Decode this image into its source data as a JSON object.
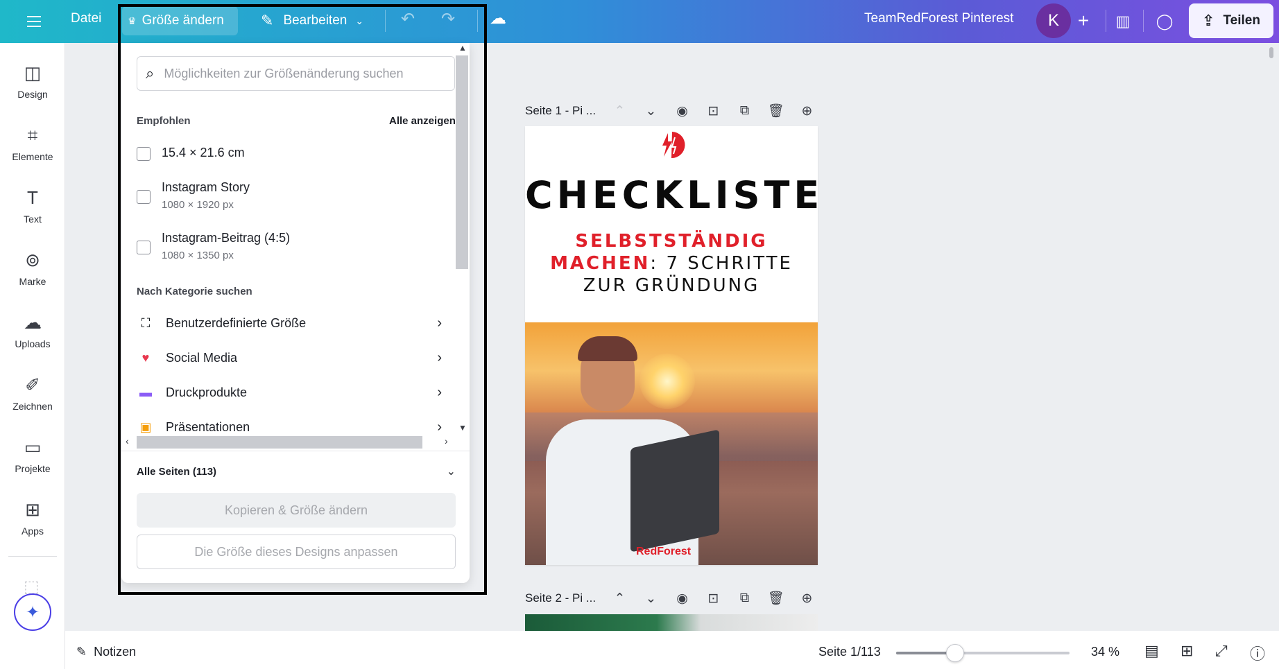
{
  "topbar": {
    "file_label": "Datei",
    "resize_label": "Größe ändern",
    "edit_label": "Bearbeiten",
    "team_name": "TeamRedForest Pinterest",
    "avatar_initial": "K",
    "share_label": "Teilen"
  },
  "sidebar": {
    "items": [
      {
        "label": "Design",
        "icon": "layout-icon"
      },
      {
        "label": "Elemente",
        "icon": "shapes-icon"
      },
      {
        "label": "Text",
        "icon": "text-icon"
      },
      {
        "label": "Marke",
        "icon": "brand-icon"
      },
      {
        "label": "Uploads",
        "icon": "cloud-upload-icon"
      },
      {
        "label": "Zeichnen",
        "icon": "draw-icon"
      },
      {
        "label": "Projekte",
        "icon": "folder-icon"
      },
      {
        "label": "Apps",
        "icon": "apps-icon"
      }
    ]
  },
  "resize_panel": {
    "search_placeholder": "Möglichkeiten zur Größenänderung suchen",
    "recommended_label": "Empfohlen",
    "show_all_label": "Alle anzeigen",
    "options": [
      {
        "title": "15.4 × 21.6 cm",
        "subtitle": ""
      },
      {
        "title": "Instagram Story",
        "subtitle": "1080 × 1920 px"
      },
      {
        "title": "Instagram-Beitrag (4:5)",
        "subtitle": "1080 × 1350 px"
      }
    ],
    "category_label": "Nach Kategorie suchen",
    "categories": [
      {
        "label": "Benutzerdefinierte Größe",
        "icon": "custom-size-icon",
        "color": "#1c1f26"
      },
      {
        "label": "Social Media",
        "icon": "heart-icon",
        "color": "#e8384f"
      },
      {
        "label": "Druckprodukte",
        "icon": "printer-icon",
        "color": "#8b5cf6"
      },
      {
        "label": "Präsentationen",
        "icon": "presentation-icon",
        "color": "#f59e0b"
      }
    ],
    "pages_label": "Alle Seiten (113)",
    "copy_button": "Kopieren & Größe ändern",
    "resize_button": "Die Größe dieses Designs anpassen"
  },
  "canvas": {
    "page1_label": "Seite 1 - Pi ...",
    "page2_label": "Seite 2 - Pi ...",
    "page1_title": "CHECKLISTE",
    "page1_sub_red1": "SELBSTSTÄNDIG",
    "page1_sub_red2": "MACHEN",
    "page1_sub_rest": ": 7 SCHRITTE",
    "page1_sub_line3": "ZUR GRÜNDUNG",
    "page1_brand": "RedForest"
  },
  "bottombar": {
    "notes_label": "Notizen",
    "page_info": "Seite 1/113",
    "zoom_value": "34 %",
    "zoom_fraction": 0.34
  },
  "colors": {
    "accent_red": "#e0202a",
    "topbar_start": "#1fb8c9",
    "topbar_end": "#7b4fe0"
  }
}
